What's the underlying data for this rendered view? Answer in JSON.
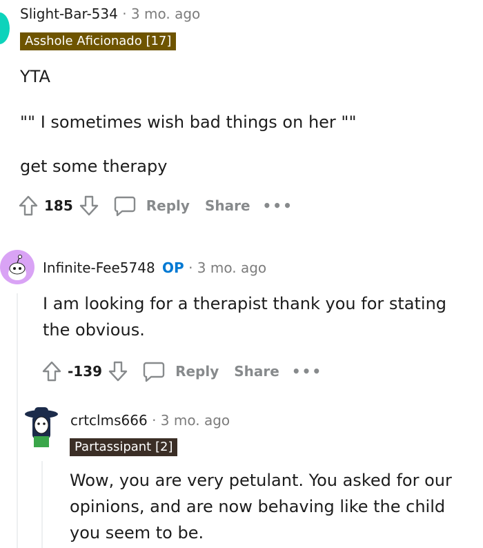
{
  "comments": [
    {
      "username": "Slight-Bar-534",
      "time": "3 mo. ago",
      "flair": "Asshole Aficionado [17]",
      "flair_color": "#6e5400",
      "body": [
        "YTA",
        "\"\" I sometimes wish bad things on her \"\"",
        "get some therapy"
      ],
      "score": "185",
      "avatar_color": "#0dd3bb"
    },
    {
      "username": "Infinite-Fee5748",
      "op_badge": "OP",
      "time": "3 mo. ago",
      "body": [
        "I am looking for a therapist thank you for stating the obvious."
      ],
      "score": "-139",
      "avatar_color": "#d9a3f5"
    },
    {
      "username": "crtclms666",
      "time": "3 mo. ago",
      "flair": "Partassipant [2]",
      "flair_color": "#3b2e26",
      "body": [
        "Wow, you are very petulant. You asked for our opinions, and are now behaving like the child you seem to be."
      ]
    }
  ],
  "actions": {
    "reply": "Reply",
    "share": "Share",
    "more": "•••"
  },
  "meta_sep": "·",
  "icons": [
    "upvote-icon",
    "downvote-icon",
    "comment-bubble-icon",
    "more-icon"
  ],
  "colors": {
    "op": "#0079d3",
    "muted": "#7c7c7c"
  }
}
